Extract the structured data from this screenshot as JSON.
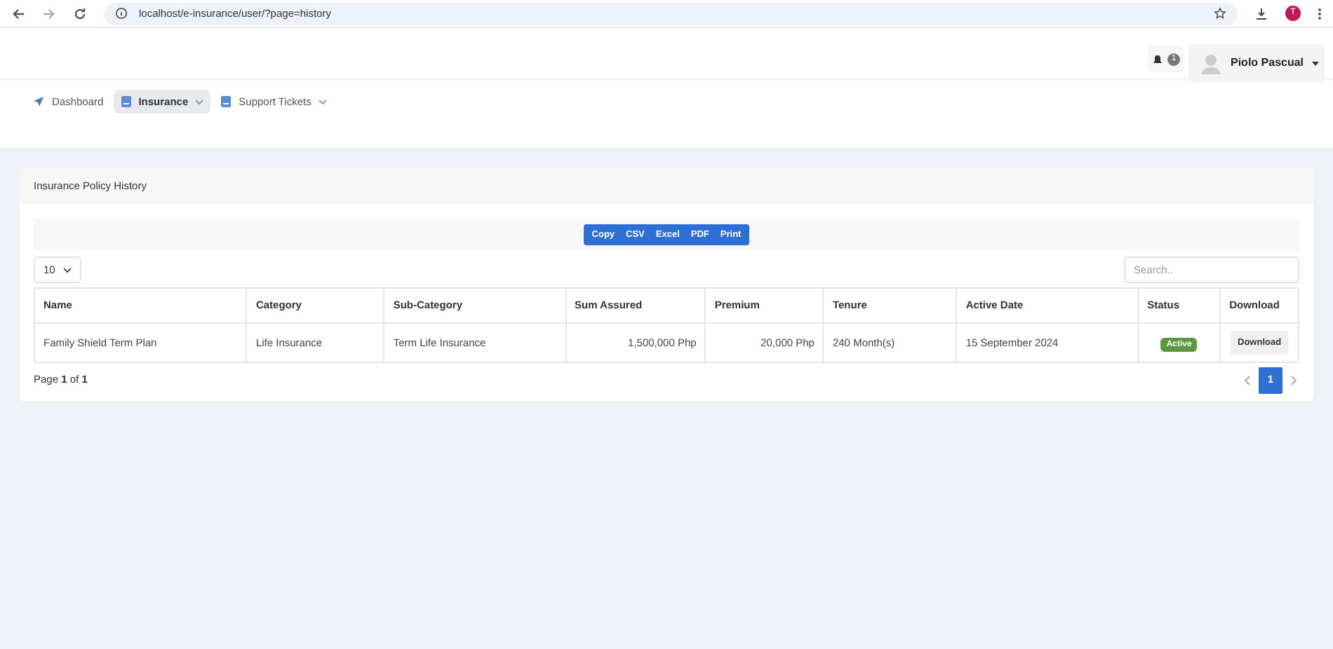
{
  "browser": {
    "url": "localhost/e-insurance/user/?page=history",
    "profile_initial": "T"
  },
  "header": {
    "notification_count": "1",
    "user_name": "Piolo Pascual"
  },
  "nav": [
    {
      "label": "Dashboard",
      "kind": "link",
      "selected": false
    },
    {
      "label": "Insurance",
      "kind": "dropdown",
      "selected": true
    },
    {
      "label": "Support Tickets",
      "kind": "dropdown",
      "selected": false
    }
  ],
  "card": {
    "title": "Insurance Policy History",
    "export_buttons": [
      "Copy",
      "CSV",
      "Excel",
      "PDF",
      "Print"
    ],
    "page_length": "10",
    "search": {
      "placeholder": "Search.."
    },
    "table": {
      "columns": [
        "Name",
        "Category",
        "Sub-Category",
        "Sum Assured",
        "Premium",
        "Tenure",
        "Active Date",
        "Status",
        "Download"
      ],
      "rows": [
        {
          "name": "Family Shield Term Plan",
          "category": "Life Insurance",
          "sub_category": "Term Life Insurance",
          "sum_assured": "1,500,000 Php",
          "premium": "20,000 Php",
          "tenure": "240 Month(s)",
          "active_date": "15 September 2024",
          "status": {
            "label": "Active",
            "color": "#5a9a3c"
          },
          "download": "Download"
        }
      ]
    },
    "page_info": "Page **1** of **1**",
    "pages": [
      {
        "label": "1",
        "selected": true
      }
    ]
  }
}
